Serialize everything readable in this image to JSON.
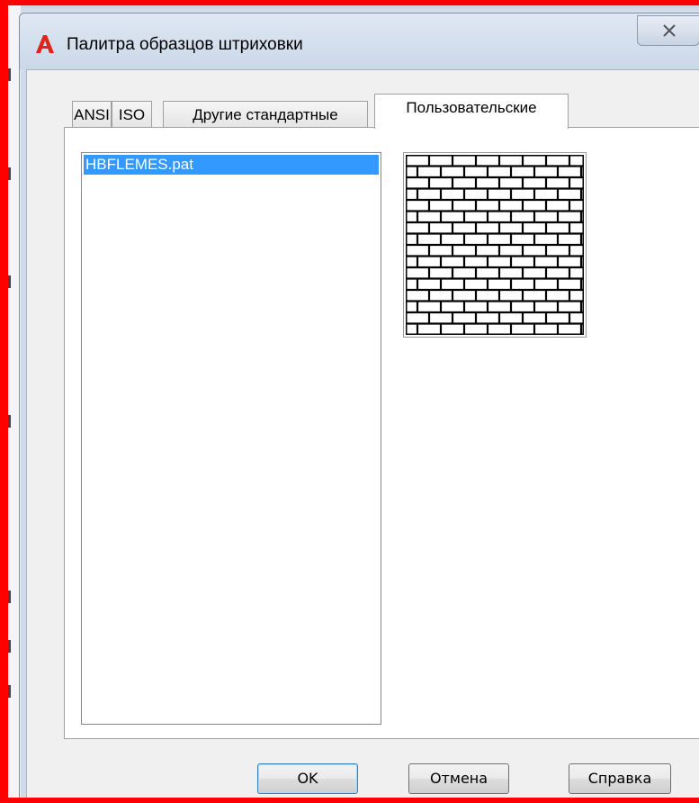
{
  "dialog": {
    "title": "Палитра образцов штриховки"
  },
  "tabs": [
    {
      "label": "ANSI",
      "active": false
    },
    {
      "label": "ISO",
      "active": false
    },
    {
      "label": "Другие стандартные",
      "active": false
    },
    {
      "label": "Пользовательские",
      "active": true
    }
  ],
  "pattern_list": {
    "items": [
      "HBFLEMES.pat"
    ],
    "selected": "HBFLEMES.pat"
  },
  "preview": {
    "pattern": "brick-icon"
  },
  "buttons": {
    "ok": "OK",
    "cancel": "Отмена",
    "help": "Справка"
  },
  "colors": {
    "selection": "#3399ff",
    "app_icon": "#e2231a",
    "highlight_frame": "#ff0000"
  }
}
